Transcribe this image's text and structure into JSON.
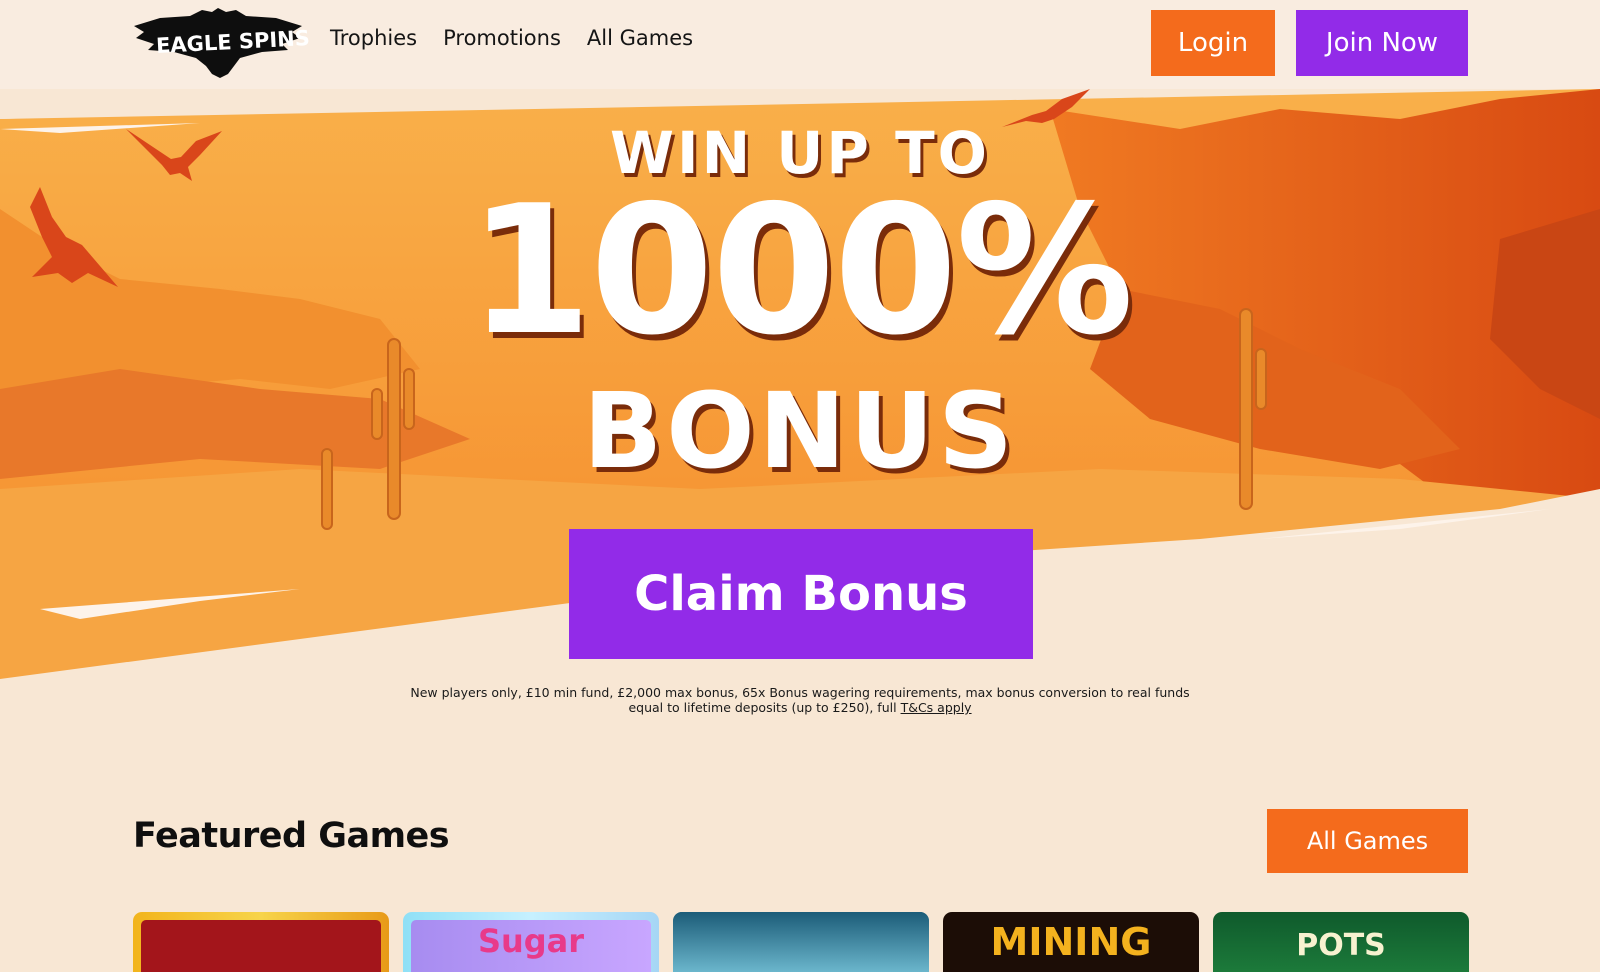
{
  "brand": {
    "logo_text": "EAGLE SPINS"
  },
  "nav": {
    "items": [
      "Trophies",
      "Promotions",
      "All Games"
    ]
  },
  "header": {
    "login_label": "Login",
    "join_label": "Join Now"
  },
  "hero": {
    "line1": "WIN UP TO",
    "line2": "1000%",
    "line3": "BONUS",
    "cta_label": "Claim Bonus",
    "terms_text": "New players only, £10 min fund, £2,000 max bonus, 65x Bonus wagering requirements, max bonus conversion to real funds equal to lifetime deposits (up to £250), full",
    "terms_link": "T&Cs apply"
  },
  "featured": {
    "title": "Featured Games",
    "all_games_label": "All Games",
    "tiles": [
      {
        "label": "",
        "name": "game-tile-1"
      },
      {
        "label": "Sugar",
        "name": "game-tile-sugar"
      },
      {
        "label": "",
        "name": "game-tile-3"
      },
      {
        "label": "MINING",
        "name": "game-tile-mining"
      },
      {
        "label": "POTS",
        "name": "game-tile-pots"
      }
    ]
  },
  "colors": {
    "orange": "#f46b1c",
    "purple": "#922be8",
    "page_bg": "#f8e7d4",
    "header_bg": "#f9ece0"
  }
}
